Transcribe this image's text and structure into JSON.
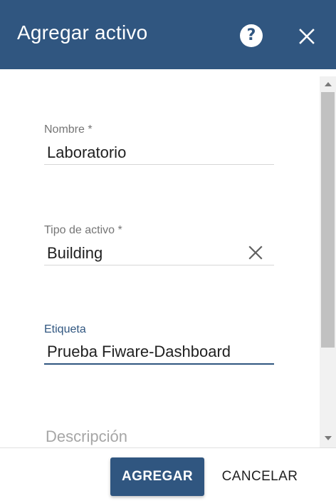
{
  "dialog": {
    "title": "Agregar activo",
    "help_icon": "help-circle-icon",
    "help_glyph": "?",
    "close_icon": "close-icon"
  },
  "fields": {
    "nombre": {
      "label": "Nombre *",
      "value": "Laboratorio"
    },
    "tipo": {
      "label": "Tipo de activo *",
      "value": "Building",
      "clear_icon": "clear-icon"
    },
    "etiqueta": {
      "label": "Etiqueta",
      "value": "Prueba Fiware-Dashboard"
    },
    "descripcion": {
      "placeholder": "Descripción"
    }
  },
  "footer": {
    "add_label": "AGREGAR",
    "cancel_label": "CANCELAR"
  },
  "colors": {
    "primary": "#305680",
    "label": "#757575",
    "divider": "#d6d6d6"
  }
}
